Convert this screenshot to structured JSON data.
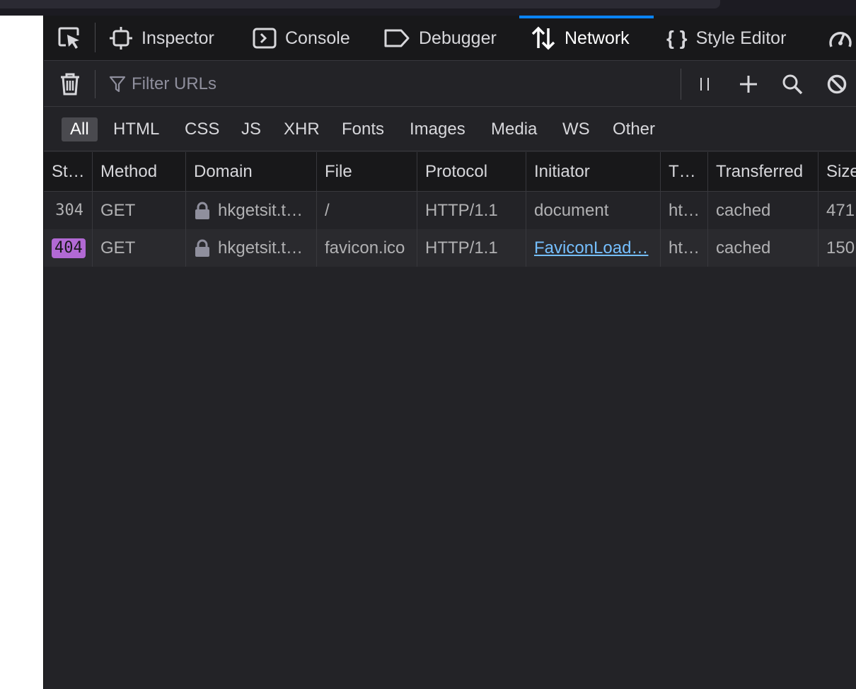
{
  "colors": {
    "accent": "#0a84ff",
    "status_404": "#b269d4",
    "link": "#75bfff",
    "panel_bg": "#232327"
  },
  "tabs": [
    {
      "label": "Inspector",
      "icon": "inspector-icon"
    },
    {
      "label": "Console",
      "icon": "console-icon"
    },
    {
      "label": "Debugger",
      "icon": "debugger-icon"
    },
    {
      "label": "Network",
      "icon": "network-icon",
      "active": true
    },
    {
      "label": "Style Editor",
      "icon": "style-editor-icon"
    }
  ],
  "toolbar": {
    "filter_placeholder": "Filter URLs"
  },
  "type_filters": [
    "All",
    "HTML",
    "CSS",
    "JS",
    "XHR",
    "Fonts",
    "Images",
    "Media",
    "WS",
    "Other"
  ],
  "table": {
    "headers": [
      "St…",
      "Method",
      "Domain",
      "File",
      "Protocol",
      "Initiator",
      "T…",
      "Transferred",
      "Size"
    ],
    "rows": [
      {
        "status": "304",
        "method": "GET",
        "domain": "hkgetsit.t…",
        "file": "/",
        "protocol": "HTTP/1.1",
        "initiator": "document",
        "type": "ht…",
        "transferred": "cached",
        "size": "471"
      },
      {
        "status": "404",
        "method": "GET",
        "domain": "hkgetsit.t…",
        "file": "favicon.ico",
        "protocol": "HTTP/1.1",
        "initiator": "FaviconLoad…",
        "type": "ht…",
        "transferred": "cached",
        "size": "150"
      }
    ]
  }
}
